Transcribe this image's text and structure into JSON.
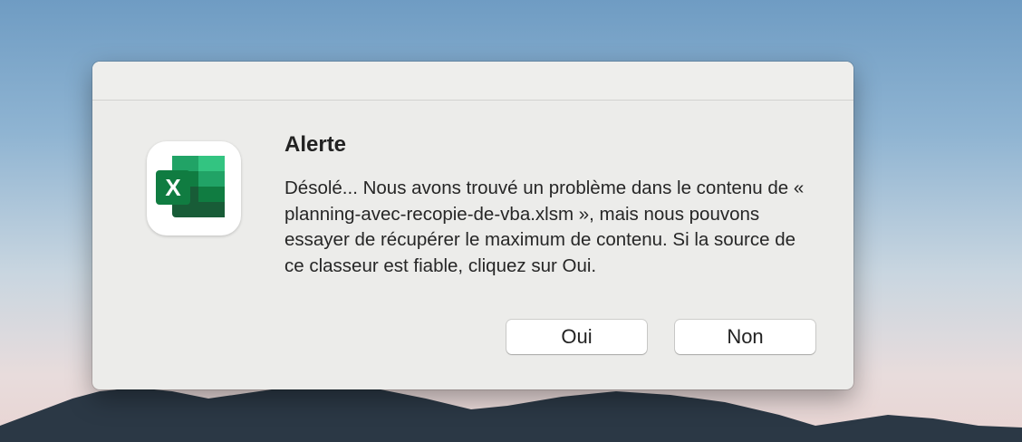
{
  "app_icon": {
    "name": "excel-icon",
    "letter": "X",
    "colors": {
      "dark_green": "#185c37",
      "mid_green": "#21a366",
      "light_green": "#33c481",
      "teal": "#107c41"
    }
  },
  "alert": {
    "title": "Alerte",
    "message": "Désolé... Nous avons trouvé un problème dans le contenu de « planning-avec-recopie-de-vba.xlsm », mais nous pouvons essayer de récupérer le maximum de contenu. Si la source de ce classeur est fiable, cliquez sur Oui."
  },
  "buttons": {
    "yes_label": "Oui",
    "no_label": "Non"
  }
}
